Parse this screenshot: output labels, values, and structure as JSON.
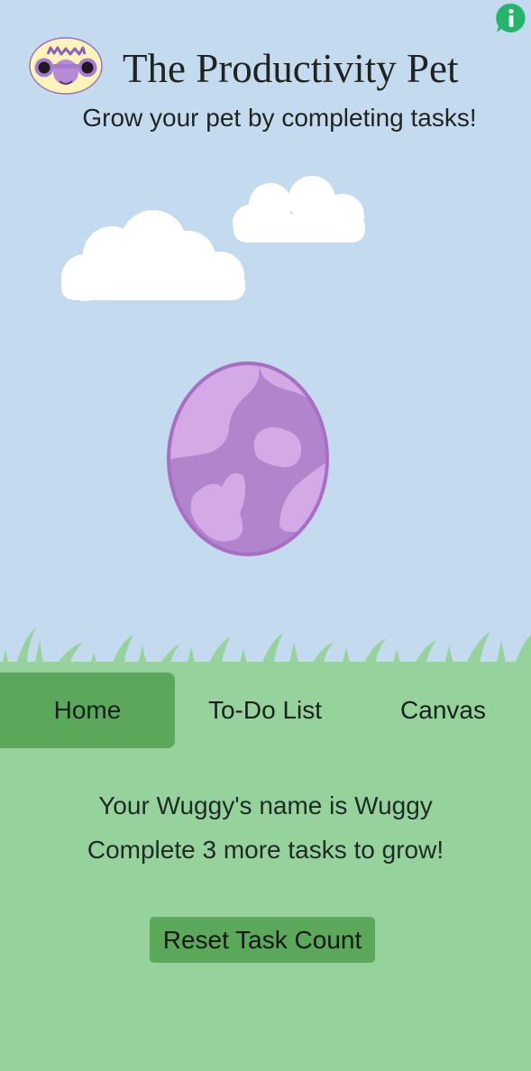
{
  "app": {
    "title": "The Productivity Pet",
    "subtitle": "Grow your pet by completing tasks!",
    "logo_text": "Wuggy"
  },
  "icons": {
    "info": "info-icon",
    "logo": "wuggy-logo"
  },
  "nav": {
    "tabs": [
      {
        "label": "Home",
        "active": true
      },
      {
        "label": "To-Do List",
        "active": false
      },
      {
        "label": "Canvas",
        "active": false
      }
    ]
  },
  "home": {
    "name_message": "Your Wuggy's name is Wuggy",
    "grow_message": "Complete 3 more tasks to grow!",
    "reset_label": "Reset Task Count"
  },
  "colors": {
    "sky": "#c4daee",
    "ground": "#96d39c",
    "active_tab": "#5ba85a",
    "button": "#5ba85a",
    "egg": "#b184cc",
    "egg_spots": "#d3aae6",
    "info": "#24b56a"
  }
}
